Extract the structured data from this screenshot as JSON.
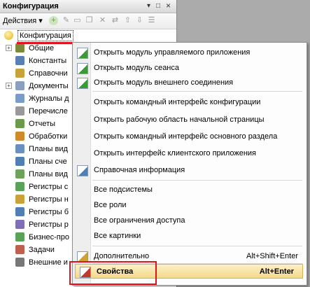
{
  "panel": {
    "title": "Конфигурация",
    "controls": {
      "pin": "▾",
      "win": "□",
      "close": "×"
    },
    "actions_label": "Действия ▾"
  },
  "tree": {
    "root_label": "Конфигурация",
    "items": [
      {
        "label": "Общие",
        "expander": "+",
        "icon": "common-icon",
        "color": "#7a8a3a"
      },
      {
        "label": "Константы",
        "expander": "",
        "icon": "constants-icon",
        "color": "#5a7fb5"
      },
      {
        "label": "Справочни",
        "expander": "",
        "icon": "catalogs-icon",
        "color": "#c9a23b"
      },
      {
        "label": "Документы",
        "expander": "+",
        "icon": "documents-icon",
        "color": "#8aa0c0"
      },
      {
        "label": "Журналы д",
        "expander": "",
        "icon": "journals-icon",
        "color": "#7a9cc9"
      },
      {
        "label": "Перечисле",
        "expander": "",
        "icon": "enums-icon",
        "color": "#999999"
      },
      {
        "label": "Отчеты",
        "expander": "",
        "icon": "reports-icon",
        "color": "#6a9a4a"
      },
      {
        "label": "Обработки",
        "expander": "",
        "icon": "dataprocessors-icon",
        "color": "#d08a2a"
      },
      {
        "label": "Планы вид",
        "expander": "",
        "icon": "chart-types-icon",
        "color": "#6b8fbf"
      },
      {
        "label": "Планы сче",
        "expander": "",
        "icon": "chart-accounts-icon",
        "color": "#4f7fb5"
      },
      {
        "label": "Планы вид",
        "expander": "",
        "icon": "calc-types-icon",
        "color": "#6fa35a"
      },
      {
        "label": "Регистры с",
        "expander": "",
        "icon": "info-registers-icon",
        "color": "#5aa25a"
      },
      {
        "label": "Регистры н",
        "expander": "",
        "icon": "accum-registers-icon",
        "color": "#c9a23b"
      },
      {
        "label": "Регистры б",
        "expander": "",
        "icon": "acc-registers-icon",
        "color": "#4f7fb5"
      },
      {
        "label": "Регистры р",
        "expander": "",
        "icon": "calc-registers-icon",
        "color": "#7f6fb5"
      },
      {
        "label": "Бизнес-про",
        "expander": "",
        "icon": "bizproc-icon",
        "color": "#5aa25a"
      },
      {
        "label": "Задачи",
        "expander": "",
        "icon": "tasks-icon",
        "color": "#bf5f4f"
      },
      {
        "label": "Внешние и",
        "expander": "",
        "icon": "external-icon",
        "color": "#777777"
      }
    ]
  },
  "context_menu": {
    "items": [
      {
        "label": "Открыть модуль управляемого приложения",
        "icon": "module-icon"
      },
      {
        "label": "Открыть модуль сеанса",
        "icon": "module-icon"
      },
      {
        "label": "Открыть модуль внешнего соединения",
        "icon": "module-icon"
      },
      {
        "label": "Открыть командный интерфейс конфигурации",
        "icon": ""
      },
      {
        "label": "Открыть рабочую область начальной страницы",
        "icon": ""
      },
      {
        "label": "Открыть командный интерфейс основного раздела",
        "icon": ""
      },
      {
        "label": "Открыть интерфейс клиентского приложения",
        "icon": ""
      },
      {
        "label": "Справочная информация",
        "icon": "help-icon"
      },
      {
        "label": "Все подсистемы",
        "icon": ""
      },
      {
        "label": "Все роли",
        "icon": ""
      },
      {
        "label": "Все ограничения доступа",
        "icon": ""
      },
      {
        "label": "Все картинки",
        "icon": ""
      },
      {
        "label": "Дополнительно",
        "icon": "more-icon",
        "shortcut": "Alt+Shift+Enter"
      },
      {
        "label": "Свойства",
        "icon": "properties-icon",
        "shortcut": "Alt+Enter"
      }
    ]
  },
  "colors": {
    "highlight_red": "#e0141e",
    "hover_bg": "#f4d98a"
  }
}
